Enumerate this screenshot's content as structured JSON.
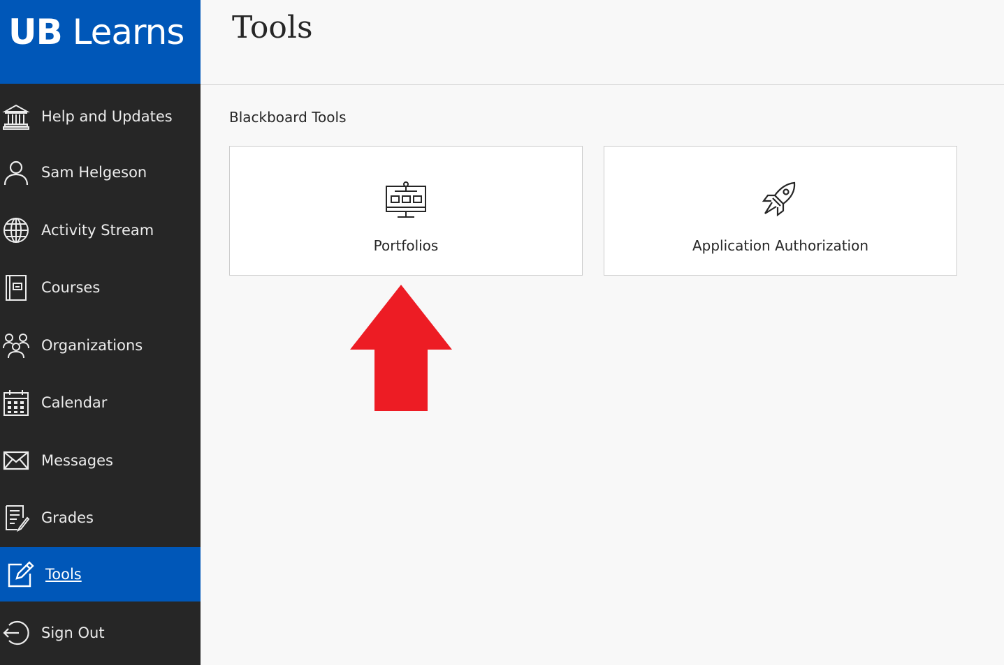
{
  "brand": {
    "ub": "UB",
    "learns": " Learns",
    "color": "#0057b8"
  },
  "sidebar": {
    "items": [
      {
        "label": "Help and Updates",
        "icon": "institution-icon"
      },
      {
        "label": "Sam Helgeson",
        "icon": "user-icon"
      },
      {
        "label": "Activity Stream",
        "icon": "globe-icon"
      },
      {
        "label": "Courses",
        "icon": "course-book-icon"
      },
      {
        "label": "Organizations",
        "icon": "organizations-icon"
      },
      {
        "label": "Calendar",
        "icon": "calendar-icon"
      },
      {
        "label": "Messages",
        "icon": "envelope-icon"
      },
      {
        "label": "Grades",
        "icon": "grades-icon"
      },
      {
        "label": "Tools",
        "icon": "tools-edit-icon",
        "active": true
      },
      {
        "label": "Sign Out",
        "icon": "sign-out-icon"
      }
    ]
  },
  "header": {
    "title": "Tools"
  },
  "main": {
    "section_title": "Blackboard Tools",
    "tools": [
      {
        "label": "Portfolios",
        "icon": "portfolio-monitor-icon"
      },
      {
        "label": "Application Authorization",
        "icon": "rocket-icon"
      }
    ]
  },
  "annotation": {
    "icon": "red-arrow-up-icon",
    "color": "#ed1c24"
  }
}
